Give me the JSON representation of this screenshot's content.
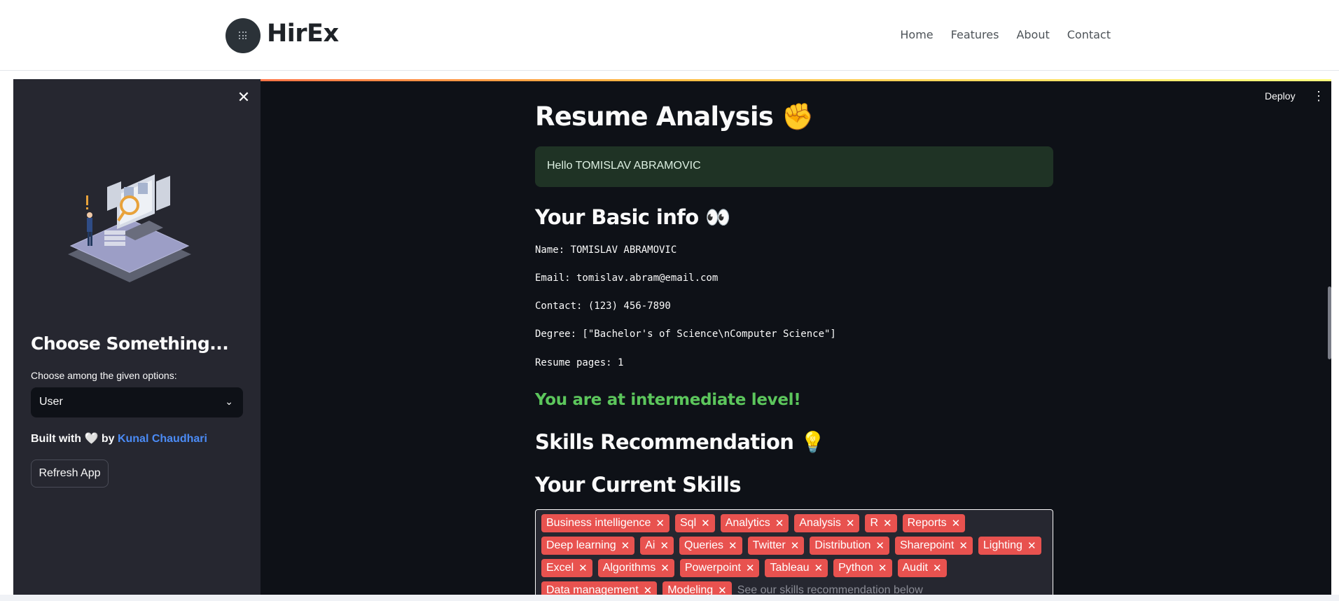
{
  "navbar": {
    "brand": "HirEx",
    "links": [
      "Home",
      "Features",
      "About",
      "Contact"
    ]
  },
  "toolbar": {
    "deploy_label": "Deploy",
    "menu_icon": "kebab-menu-icon"
  },
  "sidebar": {
    "close_icon": "close-icon",
    "heading": "Choose Something...",
    "select_label": "Choose among the given options:",
    "select_value": "User",
    "built_with_prefix": "Built with",
    "built_with_icon": "heart-icon",
    "built_with_by": "by",
    "author": "Kunal Chaudhari",
    "refresh_label": "Refresh App"
  },
  "main": {
    "title": "Resume Analysis",
    "title_emoji": "✊",
    "greeting": "Hello TOMISLAV ABRAMOVIC",
    "basic_info_heading": "Your Basic info",
    "basic_info_emoji": "👀",
    "info": {
      "name": "Name: TOMISLAV ABRAMOVIC",
      "email": "Email: tomislav.abram@email.com",
      "contact": "Contact: (123) 456-7890",
      "degree": "Degree: [\"Bachelor's of Science\\nComputer Science\"]",
      "pages": "Resume pages: 1"
    },
    "level_message": "You are at intermediate level!",
    "skills_rec_heading": "Skills Recommendation",
    "skills_rec_emoji": "💡",
    "current_skills_heading": "Your Current Skills",
    "skills": [
      "Business intelligence",
      "Sql",
      "Analytics",
      "Analysis",
      "R",
      "Reports",
      "Deep learning",
      "Ai",
      "Queries",
      "Twitter",
      "Distribution",
      "Sharepoint",
      "Lighting",
      "Excel",
      "Algorithms",
      "Powerpoint",
      "Tableau",
      "Python",
      "Audit",
      "Data management",
      "Modeling"
    ],
    "skills_placeholder": "See our skills recommendation below"
  },
  "colors": {
    "accent": "#ff4b4b",
    "success": "#5cc65c",
    "link": "#4b8bf5",
    "app_bg": "#0e1117",
    "sidebar_bg": "#262730"
  }
}
